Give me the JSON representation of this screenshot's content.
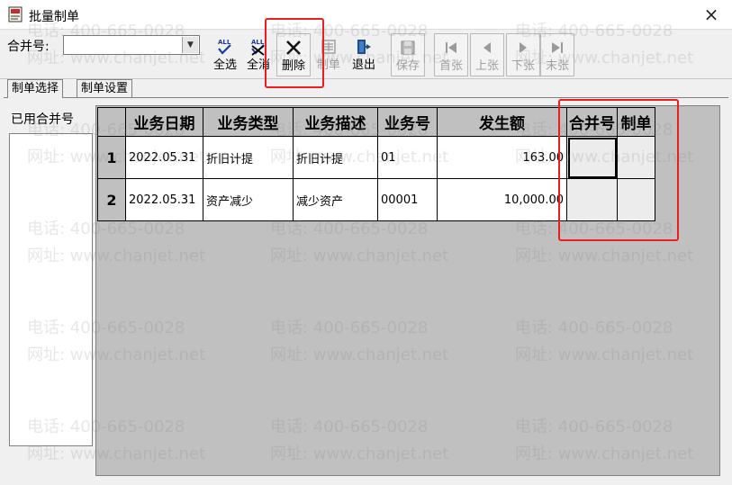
{
  "window": {
    "title": "批量制单",
    "close_icon": "×"
  },
  "toolbar": {
    "merge_label": "合并号:",
    "merge_value": "",
    "buttons": [
      {
        "id": "select-all",
        "label": "全选",
        "icon": "select-all-icon",
        "enabled": true
      },
      {
        "id": "deselect-all",
        "label": "全消",
        "icon": "deselect-all-icon",
        "enabled": true
      },
      {
        "id": "delete",
        "label": "删除",
        "icon": "delete-x-icon",
        "enabled": true
      },
      {
        "id": "make-voucher",
        "label": "制单",
        "icon": "make-voucher-icon",
        "enabled": false
      },
      {
        "id": "exit",
        "label": "退出",
        "icon": "exit-door-icon",
        "enabled": true
      },
      {
        "id": "save",
        "label": "保存",
        "icon": "save-disk-icon",
        "enabled": false
      },
      {
        "id": "first",
        "label": "首张",
        "icon": "first-page-icon",
        "enabled": false
      },
      {
        "id": "prev",
        "label": "上张",
        "icon": "prev-page-icon",
        "enabled": false
      },
      {
        "id": "next",
        "label": "下张",
        "icon": "next-page-icon",
        "enabled": false
      },
      {
        "id": "last",
        "label": "末张",
        "icon": "last-page-icon",
        "enabled": false
      }
    ]
  },
  "tabs": [
    {
      "label": "制单选择",
      "active": true
    },
    {
      "label": "制单设置",
      "active": false
    }
  ],
  "left_panel": {
    "label": "已用合并号"
  },
  "grid": {
    "columns": [
      "业务日期",
      "业务类型",
      "业务描述",
      "业务号",
      "发生额",
      "合并号",
      "制单"
    ],
    "rows": [
      {
        "num": "1",
        "date": "2022.05.31",
        "type": "折旧计提",
        "desc": "折旧计提",
        "no": "01",
        "amount": "163.00",
        "merge": "",
        "make": ""
      },
      {
        "num": "2",
        "date": "2022.05.31",
        "type": "资产减少",
        "desc": "减少资产",
        "no": "00001",
        "amount": "10,000.00",
        "merge": "",
        "make": ""
      }
    ]
  },
  "watermark": {
    "phone": "电话: 400-665-0028",
    "site": "网址: www.chanjet.net"
  },
  "colors": {
    "highlight": "#ee1c1c",
    "grid_background": "#c0c0c0"
  }
}
